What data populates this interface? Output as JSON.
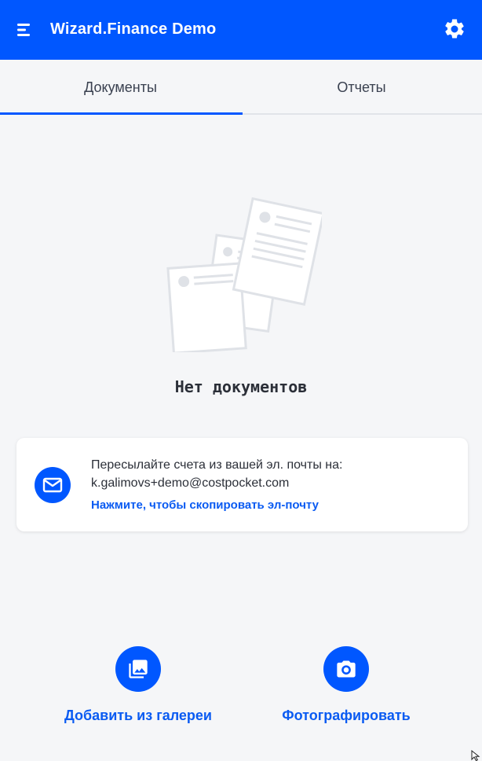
{
  "appbar": {
    "title": "Wizard.Finance Demo",
    "menu_icon": "menu-icon",
    "settings_icon": "gear-icon",
    "background": "#0057ff"
  },
  "tabs": [
    {
      "label": "Документы",
      "active": true
    },
    {
      "label": "Отчеты",
      "active": false
    }
  ],
  "empty_state": {
    "illustration": "documents-illustration",
    "title": "Нет документов"
  },
  "email_card": {
    "icon": "mail-icon",
    "instruction": "Пересылайте счета из вашей эл. почты на:",
    "email": "k.galimovs+demo@costpocket.com",
    "copy_link": "Нажмите, чтобы скопировать эл-почту"
  },
  "actions": {
    "gallery": {
      "label": "Добавить из галереи",
      "icon": "gallery-icon"
    },
    "camera": {
      "label": "Фотографировать",
      "icon": "camera-icon"
    }
  },
  "colors": {
    "accent": "#0057ff",
    "link": "#0a5bf2",
    "background": "#f5f6f8"
  }
}
